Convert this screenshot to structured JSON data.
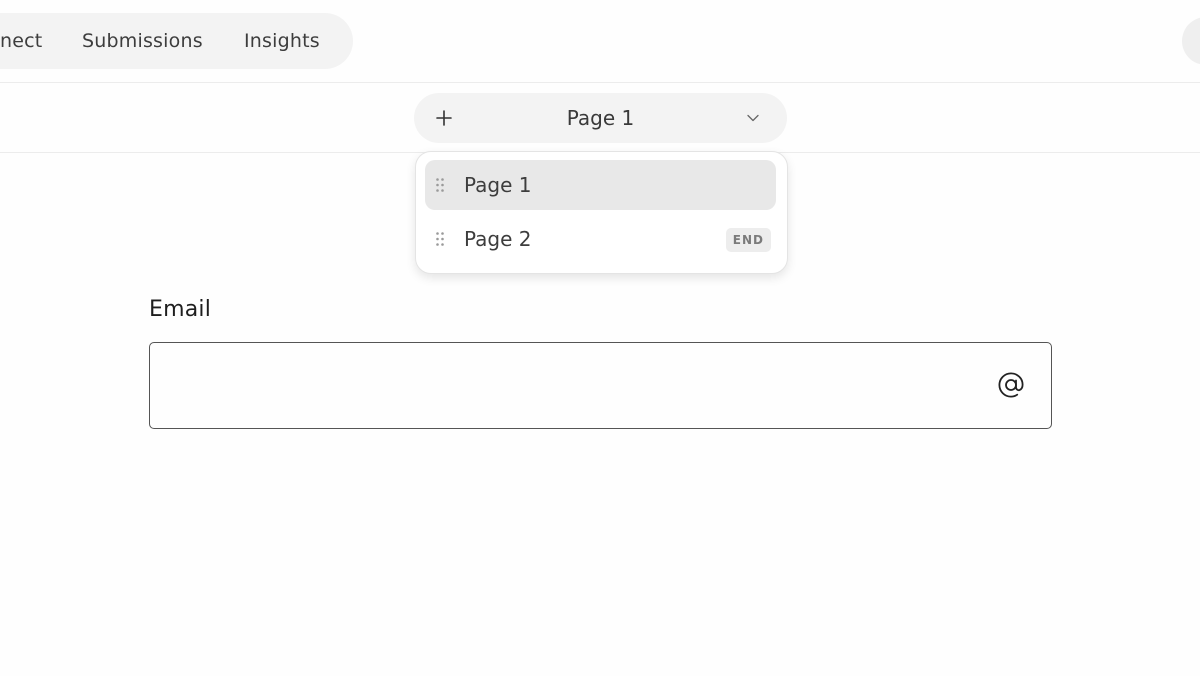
{
  "topnav": {
    "items": [
      {
        "label": "nect"
      },
      {
        "label": "Submissions"
      },
      {
        "label": "Insights"
      }
    ]
  },
  "page_switcher": {
    "current": "Page 1",
    "add_icon": "plus-icon",
    "toggle_icon": "chevron-down-icon"
  },
  "page_dropdown": {
    "items": [
      {
        "label": "Page 1",
        "selected": true
      },
      {
        "label": "Page 2",
        "badge": "END"
      }
    ],
    "handle_icon": "drag-handle-icon"
  },
  "form": {
    "email_label": "Email",
    "email_value": "",
    "email_placeholder": "",
    "email_icon": "at-sign-icon"
  },
  "colors": {
    "pill_bg": "#f3f3f3",
    "selected_bg": "#e8e8e8",
    "badge_bg": "#ededed",
    "input_border": "#555555"
  }
}
